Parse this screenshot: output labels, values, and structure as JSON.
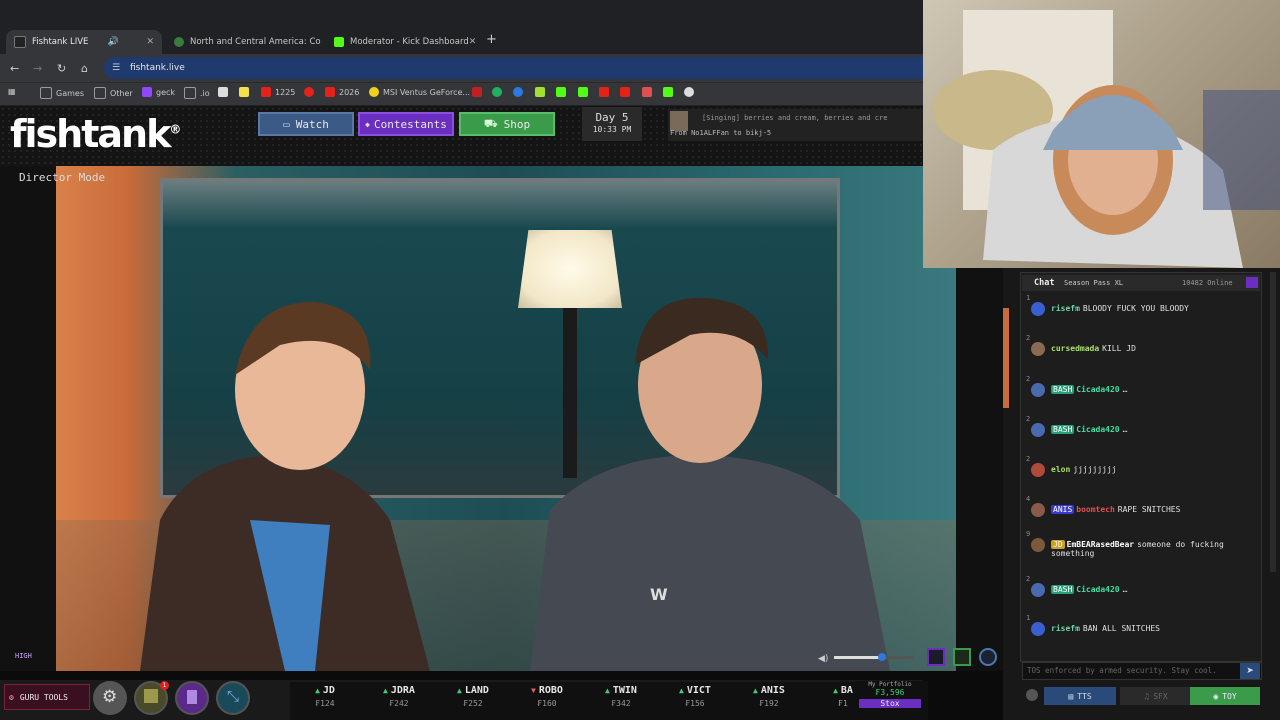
{
  "browser": {
    "tabs": [
      {
        "label": "Fishtank LIVE",
        "active": true,
        "icon": "fishtank-favicon"
      },
      {
        "label": "North and Central America: Co",
        "active": false,
        "icon": "globe-favicon"
      },
      {
        "label": "Moderator - Kick Dashboard",
        "active": false,
        "icon": "kick-favicon"
      }
    ],
    "url": "fishtank.live",
    "bookmarks": [
      {
        "label": "Games",
        "icon": "folder-icon"
      },
      {
        "label": "Other",
        "icon": "folder-icon"
      },
      {
        "label": "geck",
        "icon": "twitch-icon"
      },
      {
        "label": ".io",
        "icon": "folder-icon"
      },
      {
        "label": "1225",
        "icon": "youtube-icon"
      },
      {
        "label": "2026",
        "icon": "youtube-icon"
      },
      {
        "label": "MSI Ventus GeForce...",
        "icon": "lemon-icon"
      }
    ]
  },
  "site": {
    "logo": "fishtank",
    "logo_mark": "®",
    "nav": {
      "watch": "Watch",
      "contestants": "Contestants",
      "shop": "Shop"
    },
    "day": {
      "label": "Day 5",
      "time": "10:33 PM"
    },
    "ticker": {
      "lyric": "[Singing] berries and cream, berries and cre",
      "from": "From No1ALFFan to bikj-5"
    }
  },
  "video": {
    "mode_label": "Director Mode",
    "quality_label": "HIGH"
  },
  "chat": {
    "tab": "Chat",
    "season_pass": "Season Pass XL",
    "online": "10482 Online",
    "messages": [
      {
        "num": "1",
        "user": "risefm",
        "badge": "",
        "badge_color": "",
        "user_color": "#6fd3a8",
        "text": "BLOODY FUCK YOU BLOODY",
        "avatar": "#3a5fcf"
      },
      {
        "num": "2",
        "user": "cursedmada",
        "badge": "",
        "badge_color": "",
        "user_color": "#a8e06a",
        "text": "KILL JD",
        "avatar": "#8a6a50"
      },
      {
        "num": "2",
        "user": "Cicada420",
        "badge": "BASH",
        "badge_color": "#2a9d7a",
        "user_color": "#3ee0a0",
        "text": "…",
        "avatar": "#4a6ab0"
      },
      {
        "num": "2",
        "user": "Cicada420",
        "badge": "BASH",
        "badge_color": "#2a9d7a",
        "user_color": "#3ee0a0",
        "text": "…",
        "avatar": "#4a6ab0"
      },
      {
        "num": "2",
        "user": "elon",
        "badge": "",
        "badge_color": "",
        "user_color": "#a8e06a",
        "text": "jjjjjjjjj",
        "avatar": "#b04a3a"
      },
      {
        "num": "4",
        "user": "boomtech",
        "badge": "ANIS",
        "badge_color": "#3a3ad0",
        "user_color": "#e05050",
        "text": "RAPE SNITCHES",
        "avatar": "#8a5a4a"
      },
      {
        "num": "9",
        "user": "EmBEARasedBear",
        "badge": "JD",
        "badge_color": "#c9a020",
        "user_color": "#ffffff",
        "text": "someone do fucking something",
        "avatar": "#7a5a3a"
      },
      {
        "num": "2",
        "user": "Cicada420",
        "badge": "BASH",
        "badge_color": "#2a9d7a",
        "user_color": "#3ee0a0",
        "text": "…",
        "avatar": "#4a6ab0"
      },
      {
        "num": "1",
        "user": "risefm",
        "badge": "",
        "badge_color": "",
        "user_color": "#6fd3a8",
        "text": "BAN ALL SNITCHES",
        "avatar": "#3a5fcf"
      }
    ],
    "input_placeholder": "TOS enforced by armed security. Stay cool.",
    "buttons": {
      "tts": "TTS",
      "sfx": "SFX",
      "toy": "TOY"
    }
  },
  "bottom": {
    "guru_label": "GURU TOOLS",
    "notification_count": "1",
    "stocks": [
      {
        "ticker": "JD",
        "price": "₣124",
        "dir": "up"
      },
      {
        "ticker": "JDRA",
        "price": "₣242",
        "dir": "up"
      },
      {
        "ticker": "LAND",
        "price": "₣252",
        "dir": "up"
      },
      {
        "ticker": "ROBO",
        "price": "₣160",
        "dir": "down"
      },
      {
        "ticker": "TWIN",
        "price": "₣342",
        "dir": "up"
      },
      {
        "ticker": "VICT",
        "price": "₣156",
        "dir": "up"
      },
      {
        "ticker": "ANIS",
        "price": "₣192",
        "dir": "up"
      },
      {
        "ticker": "BA",
        "price": "₣1",
        "dir": "up"
      }
    ],
    "portfolio": {
      "label": "My Portfolio",
      "value": "₣3,596",
      "button": "Stox"
    }
  },
  "colors": {
    "accent_purple": "#6a2fc0",
    "stock_up": "#3ad07a",
    "stock_down": "#e35a5a",
    "url_bar": "#1e3a6e"
  }
}
